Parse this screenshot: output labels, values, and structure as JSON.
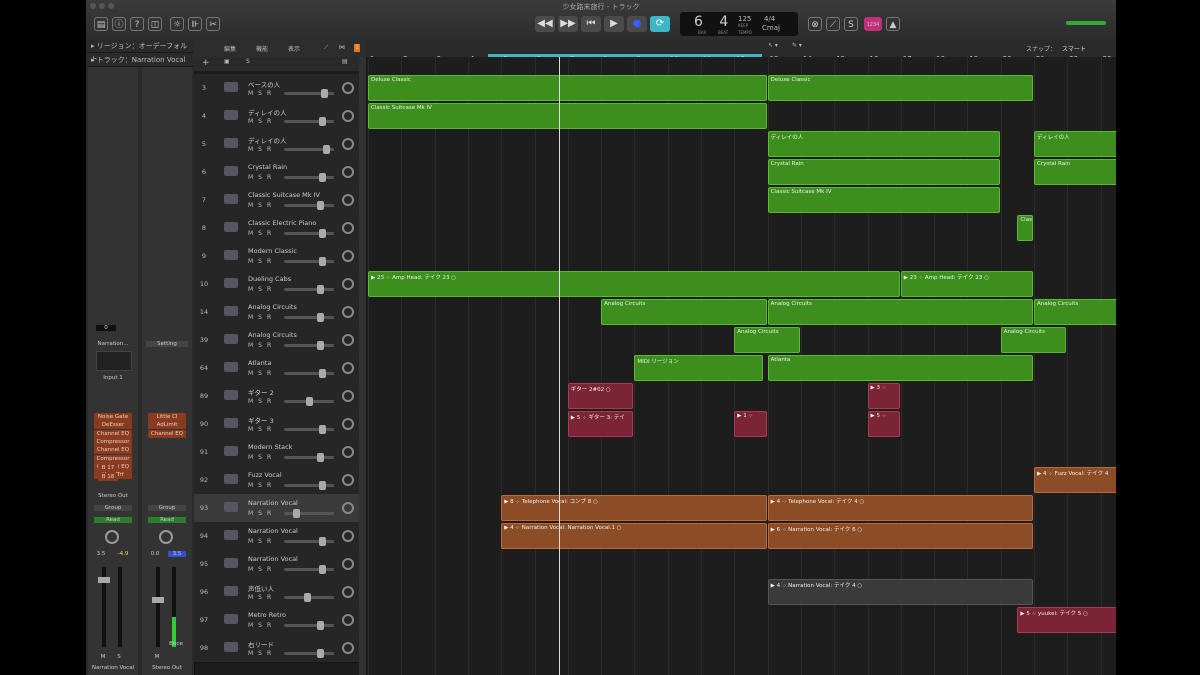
{
  "window": {
    "title": "少女路末旅行 - トラック"
  },
  "lcd": {
    "position": "6  4",
    "bar_label": "BAR",
    "beat_label": "BEAT",
    "tempo": "125",
    "tempo_label": "KEEP",
    "tempo_sub": "TEMPO",
    "sig": "4/4",
    "key": "Cmaj"
  },
  "inspector": {
    "region_label": "▸ リージョン：オーデーフォルト",
    "track_label": "▸ トラック：Narration Vocal",
    "left_strip": {
      "value": "0",
      "setting": "Narration...",
      "input": "Input 1",
      "plugins": [
        "Noise Gate",
        "DeEsser",
        "Channel EQ",
        "Compressor",
        "Channel EQ",
        "Compressor",
        "Channel EQ",
        "VocalTrf"
      ],
      "sends": [
        "B 17",
        "B 18"
      ],
      "output": "Stereo Out",
      "group": "Group",
      "automation": "Read",
      "vol": "3.5",
      "peak": "-4.9",
      "name": "Narration Vocal",
      "m": "M",
      "s": "S"
    },
    "right_strip": {
      "setting": "Setting",
      "plugins": [
        "Little Cl",
        "AdLimit",
        "Channel EQ"
      ],
      "group": "Group",
      "automation": "Read",
      "vol": "0.0",
      "peak": "3.5",
      "name": "Stereo Out",
      "bounce": "Bnce",
      "m": "M"
    }
  },
  "trackbar": {
    "menus": [
      "編集",
      "機能",
      "表示"
    ],
    "snap_label": "スナップ：",
    "snap_value": "スマート"
  },
  "ruler": {
    "bars": [
      "1",
      "2",
      "3",
      "4",
      "5",
      "6",
      "7",
      "8",
      "9",
      "10",
      "11",
      "12",
      "13",
      "14",
      "15",
      "16",
      "17",
      "18",
      "19",
      "20",
      "21",
      "22",
      "23"
    ]
  },
  "tracks": [
    {
      "num": "3",
      "name": "ベースの人"
    },
    {
      "num": "4",
      "name": "ディレイの人"
    },
    {
      "num": "5",
      "name": "ディレイの人"
    },
    {
      "num": "6",
      "name": "Crystal Rain"
    },
    {
      "num": "7",
      "name": "Classic Suitcase Mk IV"
    },
    {
      "num": "8",
      "name": "Classic Electric Piano"
    },
    {
      "num": "9",
      "name": "Modern Classic"
    },
    {
      "num": "10",
      "name": "Dueling Cabs"
    },
    {
      "num": "14",
      "name": "Analog Circuits"
    },
    {
      "num": "39",
      "name": "Analog Circuits"
    },
    {
      "num": "64",
      "name": "Atlanta"
    },
    {
      "num": "89",
      "name": "ギター 2"
    },
    {
      "num": "90",
      "name": "ギター 3"
    },
    {
      "num": "91",
      "name": "Modern Stack"
    },
    {
      "num": "92",
      "name": "Fuzz Vocal"
    },
    {
      "num": "93",
      "name": "Narration Vocal"
    },
    {
      "num": "94",
      "name": "Narration Vocal"
    },
    {
      "num": "95",
      "name": "Narration Vocal"
    },
    {
      "num": "96",
      "name": "声低い人"
    },
    {
      "num": "97",
      "name": "Metro Retro"
    },
    {
      "num": "98",
      "name": "右リード"
    }
  ],
  "regions": [
    {
      "label": "Deluxe Classic"
    },
    {
      "label": "Deluxe Classic"
    },
    {
      "label": "Classic Suitcase Mk IV"
    },
    {
      "label": "ディレイの人"
    },
    {
      "label": "ディレイの人"
    },
    {
      "label": "Crystal Rain"
    },
    {
      "label": "Crystal Rain"
    },
    {
      "label": "Classic Suitcase Mk IV"
    },
    {
      "label": "Clas"
    },
    {
      "label": "▶ 23 ⁘ Amp Head: テイク 23 ○"
    },
    {
      "label": "▶ 23 ⁘ Amp Head: テイク 23 ○"
    },
    {
      "label": "Analog Circuits"
    },
    {
      "label": "Analog Circuits"
    },
    {
      "label": "Analog Circuits"
    },
    {
      "label": "Analog Circuits"
    },
    {
      "label": "Analog Circuits"
    },
    {
      "label": "MIDI リージョン"
    },
    {
      "label": "Atlanta"
    },
    {
      "label": "ギター 2#02 ○"
    },
    {
      "label": "▶ 3 ⁘"
    },
    {
      "label": "▶ 5 ⁘ ギター 3: テイ"
    },
    {
      "label": "▶ 1 ⁘"
    },
    {
      "label": "▶ 5 ⁘"
    },
    {
      "label": "▶ 4 ⁘ Fuzz Vocal: テイク 4"
    },
    {
      "label": "▶ 8 ⁘ Telephone Vocal: コンプ 8 ○"
    },
    {
      "label": "▶ 4 ⁘ Telephone Vocal: テイク 4 ○"
    },
    {
      "label": "▶ 4 ⁘ Narration Vocal: Narration Vocal.1 ○"
    },
    {
      "label": "▶ 6 ⁘ Narration Vocal: テイク 6 ○"
    },
    {
      "label": "▶ 4 ⁘ Narration Vocal: テイク 4 ○"
    },
    {
      "label": "▶ 5 ⁘ yuukei: テイク 5 ○"
    }
  ],
  "colors": {
    "green": "#3d8f1d",
    "red": "#7a2436",
    "brown": "#8c4d26",
    "grey": "#3a3a3a",
    "cycle": "#3fb6c6"
  }
}
